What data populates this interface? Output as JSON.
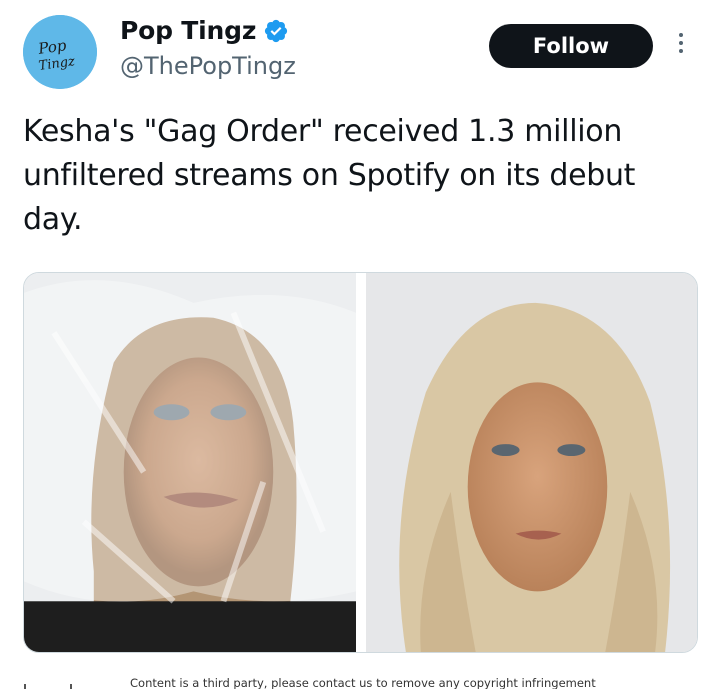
{
  "author": {
    "display_name": "Pop Tingz",
    "handle": "@ThePopTingz",
    "avatar_text": "Pop Tingz",
    "verified": true
  },
  "actions": {
    "follow_label": "Follow",
    "more_icon": "more-vertical-icon"
  },
  "tweet": {
    "text": "Kesha's \"Gag Order\" received 1.3 million unfiltered streams on Spotify on its debut day."
  },
  "media": {
    "count": 2,
    "photos": [
      "photo-plastic-wrap",
      "photo-portrait"
    ]
  },
  "footer": {
    "caption": "Content is a third party, please contact us to remove any copyright infringement"
  },
  "colors": {
    "verified": "#1d9bf0",
    "avatar_bg": "#5fb8e8",
    "follow_bg": "#0f1419",
    "secondary_text": "#536471"
  }
}
